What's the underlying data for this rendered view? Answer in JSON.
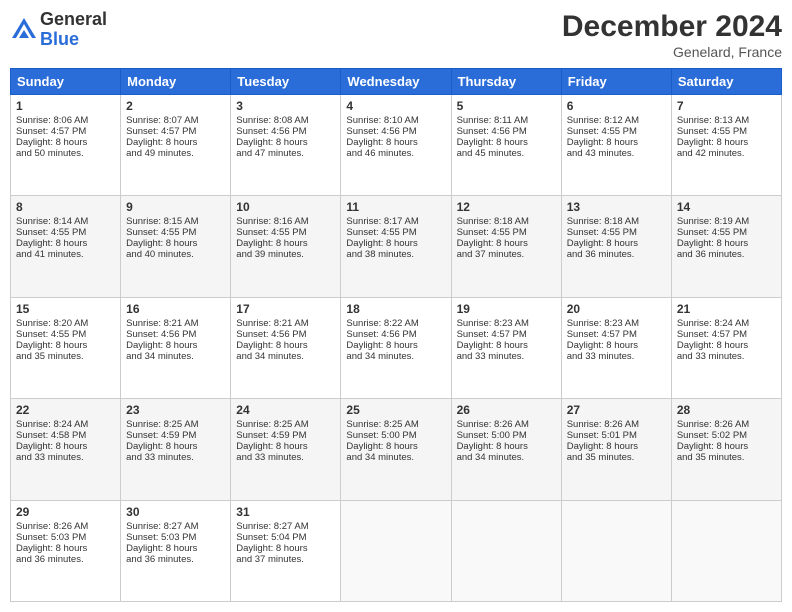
{
  "logo": {
    "general": "General",
    "blue": "Blue"
  },
  "title": "December 2024",
  "location": "Genelard, France",
  "days_header": [
    "Sunday",
    "Monday",
    "Tuesday",
    "Wednesday",
    "Thursday",
    "Friday",
    "Saturday"
  ],
  "weeks": [
    [
      {
        "day": "1",
        "lines": [
          "Sunrise: 8:06 AM",
          "Sunset: 4:57 PM",
          "Daylight: 8 hours",
          "and 50 minutes."
        ]
      },
      {
        "day": "2",
        "lines": [
          "Sunrise: 8:07 AM",
          "Sunset: 4:57 PM",
          "Daylight: 8 hours",
          "and 49 minutes."
        ]
      },
      {
        "day": "3",
        "lines": [
          "Sunrise: 8:08 AM",
          "Sunset: 4:56 PM",
          "Daylight: 8 hours",
          "and 47 minutes."
        ]
      },
      {
        "day": "4",
        "lines": [
          "Sunrise: 8:10 AM",
          "Sunset: 4:56 PM",
          "Daylight: 8 hours",
          "and 46 minutes."
        ]
      },
      {
        "day": "5",
        "lines": [
          "Sunrise: 8:11 AM",
          "Sunset: 4:56 PM",
          "Daylight: 8 hours",
          "and 45 minutes."
        ]
      },
      {
        "day": "6",
        "lines": [
          "Sunrise: 8:12 AM",
          "Sunset: 4:55 PM",
          "Daylight: 8 hours",
          "and 43 minutes."
        ]
      },
      {
        "day": "7",
        "lines": [
          "Sunrise: 8:13 AM",
          "Sunset: 4:55 PM",
          "Daylight: 8 hours",
          "and 42 minutes."
        ]
      }
    ],
    [
      {
        "day": "8",
        "lines": [
          "Sunrise: 8:14 AM",
          "Sunset: 4:55 PM",
          "Daylight: 8 hours",
          "and 41 minutes."
        ]
      },
      {
        "day": "9",
        "lines": [
          "Sunrise: 8:15 AM",
          "Sunset: 4:55 PM",
          "Daylight: 8 hours",
          "and 40 minutes."
        ]
      },
      {
        "day": "10",
        "lines": [
          "Sunrise: 8:16 AM",
          "Sunset: 4:55 PM",
          "Daylight: 8 hours",
          "and 39 minutes."
        ]
      },
      {
        "day": "11",
        "lines": [
          "Sunrise: 8:17 AM",
          "Sunset: 4:55 PM",
          "Daylight: 8 hours",
          "and 38 minutes."
        ]
      },
      {
        "day": "12",
        "lines": [
          "Sunrise: 8:18 AM",
          "Sunset: 4:55 PM",
          "Daylight: 8 hours",
          "and 37 minutes."
        ]
      },
      {
        "day": "13",
        "lines": [
          "Sunrise: 8:18 AM",
          "Sunset: 4:55 PM",
          "Daylight: 8 hours",
          "and 36 minutes."
        ]
      },
      {
        "day": "14",
        "lines": [
          "Sunrise: 8:19 AM",
          "Sunset: 4:55 PM",
          "Daylight: 8 hours",
          "and 36 minutes."
        ]
      }
    ],
    [
      {
        "day": "15",
        "lines": [
          "Sunrise: 8:20 AM",
          "Sunset: 4:55 PM",
          "Daylight: 8 hours",
          "and 35 minutes."
        ]
      },
      {
        "day": "16",
        "lines": [
          "Sunrise: 8:21 AM",
          "Sunset: 4:56 PM",
          "Daylight: 8 hours",
          "and 34 minutes."
        ]
      },
      {
        "day": "17",
        "lines": [
          "Sunrise: 8:21 AM",
          "Sunset: 4:56 PM",
          "Daylight: 8 hours",
          "and 34 minutes."
        ]
      },
      {
        "day": "18",
        "lines": [
          "Sunrise: 8:22 AM",
          "Sunset: 4:56 PM",
          "Daylight: 8 hours",
          "and 34 minutes."
        ]
      },
      {
        "day": "19",
        "lines": [
          "Sunrise: 8:23 AM",
          "Sunset: 4:57 PM",
          "Daylight: 8 hours",
          "and 33 minutes."
        ]
      },
      {
        "day": "20",
        "lines": [
          "Sunrise: 8:23 AM",
          "Sunset: 4:57 PM",
          "Daylight: 8 hours",
          "and 33 minutes."
        ]
      },
      {
        "day": "21",
        "lines": [
          "Sunrise: 8:24 AM",
          "Sunset: 4:57 PM",
          "Daylight: 8 hours",
          "and 33 minutes."
        ]
      }
    ],
    [
      {
        "day": "22",
        "lines": [
          "Sunrise: 8:24 AM",
          "Sunset: 4:58 PM",
          "Daylight: 8 hours",
          "and 33 minutes."
        ]
      },
      {
        "day": "23",
        "lines": [
          "Sunrise: 8:25 AM",
          "Sunset: 4:59 PM",
          "Daylight: 8 hours",
          "and 33 minutes."
        ]
      },
      {
        "day": "24",
        "lines": [
          "Sunrise: 8:25 AM",
          "Sunset: 4:59 PM",
          "Daylight: 8 hours",
          "and 33 minutes."
        ]
      },
      {
        "day": "25",
        "lines": [
          "Sunrise: 8:25 AM",
          "Sunset: 5:00 PM",
          "Daylight: 8 hours",
          "and 34 minutes."
        ]
      },
      {
        "day": "26",
        "lines": [
          "Sunrise: 8:26 AM",
          "Sunset: 5:00 PM",
          "Daylight: 8 hours",
          "and 34 minutes."
        ]
      },
      {
        "day": "27",
        "lines": [
          "Sunrise: 8:26 AM",
          "Sunset: 5:01 PM",
          "Daylight: 8 hours",
          "and 35 minutes."
        ]
      },
      {
        "day": "28",
        "lines": [
          "Sunrise: 8:26 AM",
          "Sunset: 5:02 PM",
          "Daylight: 8 hours",
          "and 35 minutes."
        ]
      }
    ],
    [
      {
        "day": "29",
        "lines": [
          "Sunrise: 8:26 AM",
          "Sunset: 5:03 PM",
          "Daylight: 8 hours",
          "and 36 minutes."
        ]
      },
      {
        "day": "30",
        "lines": [
          "Sunrise: 8:27 AM",
          "Sunset: 5:03 PM",
          "Daylight: 8 hours",
          "and 36 minutes."
        ]
      },
      {
        "day": "31",
        "lines": [
          "Sunrise: 8:27 AM",
          "Sunset: 5:04 PM",
          "Daylight: 8 hours",
          "and 37 minutes."
        ]
      },
      null,
      null,
      null,
      null
    ]
  ]
}
